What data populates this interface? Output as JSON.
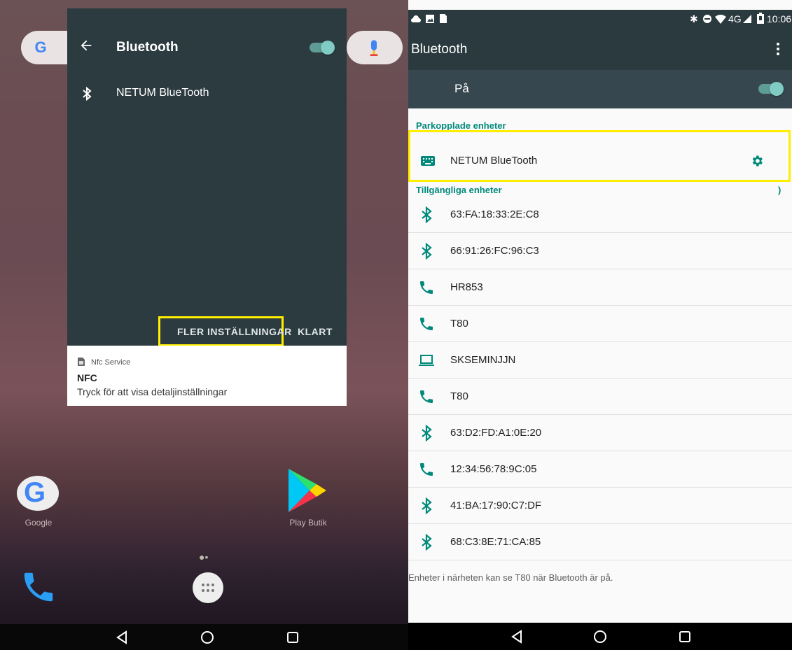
{
  "left": {
    "google_letter": "G",
    "dialog": {
      "title": "Bluetooth",
      "toggle_on": true,
      "device": "NETUM BlueTooth",
      "more_settings_button": "FLER INSTÄLLNINGAR",
      "done_button": "KLART"
    },
    "notification": {
      "app": "Nfc Service",
      "title": "NFC",
      "text": "Tryck för att visa detaljinställningar"
    },
    "apps": {
      "google_label": "Google",
      "play_label": "Play Butik"
    }
  },
  "right": {
    "status": {
      "time": "10:06",
      "network": "4G"
    },
    "toolbar": {
      "title": "Bluetooth"
    },
    "on_row": {
      "label": "På",
      "toggle_on": true
    },
    "paired_header": "Parkopplade enheter",
    "paired": [
      {
        "label": "NETUM BlueTooth",
        "icon": "keyboard-icon"
      }
    ],
    "available_header": "Tillgängliga enheter",
    "available_indicator": ")",
    "available": [
      {
        "label": "63:FA:18:33:2E:C8",
        "icon": "bluetooth-icon"
      },
      {
        "label": "66:91:26:FC:96:C3",
        "icon": "bluetooth-icon"
      },
      {
        "label": "HR853",
        "icon": "phone-icon"
      },
      {
        "label": "T80",
        "icon": "phone-icon"
      },
      {
        "label": "SKSEMINJJN",
        "icon": "laptop-icon"
      },
      {
        "label": "T80",
        "icon": "phone-icon"
      },
      {
        "label": "63:D2:FD:A1:0E:20",
        "icon": "bluetooth-icon"
      },
      {
        "label": "12:34:56:78:9C:05",
        "icon": "phone-icon"
      },
      {
        "label": "41:BA:17:90:C7:DF",
        "icon": "bluetooth-icon"
      },
      {
        "label": "68:C3:8E:71:CA:85",
        "icon": "bluetooth-icon"
      }
    ],
    "footer": "Enheter i närheten kan se T80 när Bluetooth är på."
  },
  "colors": {
    "accent": "#00897b",
    "toggle": "#80cbc4",
    "highlight": "#ffee00",
    "toolbar": "#2a3a3f"
  }
}
